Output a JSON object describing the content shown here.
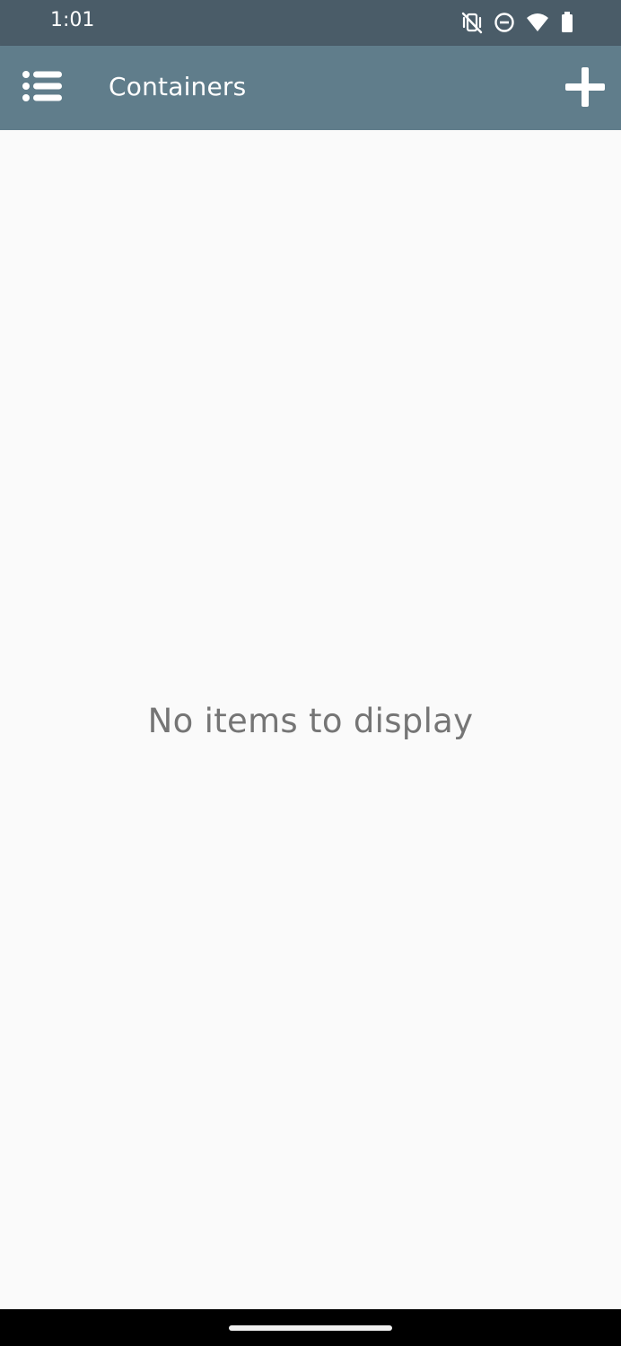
{
  "status_bar": {
    "time": "1:01",
    "icons": [
      "vibrate-off-icon",
      "do-not-disturb-icon",
      "wifi-icon",
      "battery-icon"
    ]
  },
  "app_bar": {
    "title": "Containers",
    "menu_icon": "list-menu-icon",
    "add_icon": "plus-icon"
  },
  "main": {
    "empty_message": "No items to display"
  },
  "colors": {
    "status_bar": "#4a5c68",
    "app_bar": "#607d8b",
    "background": "#fafafa",
    "empty_text": "#757575"
  }
}
